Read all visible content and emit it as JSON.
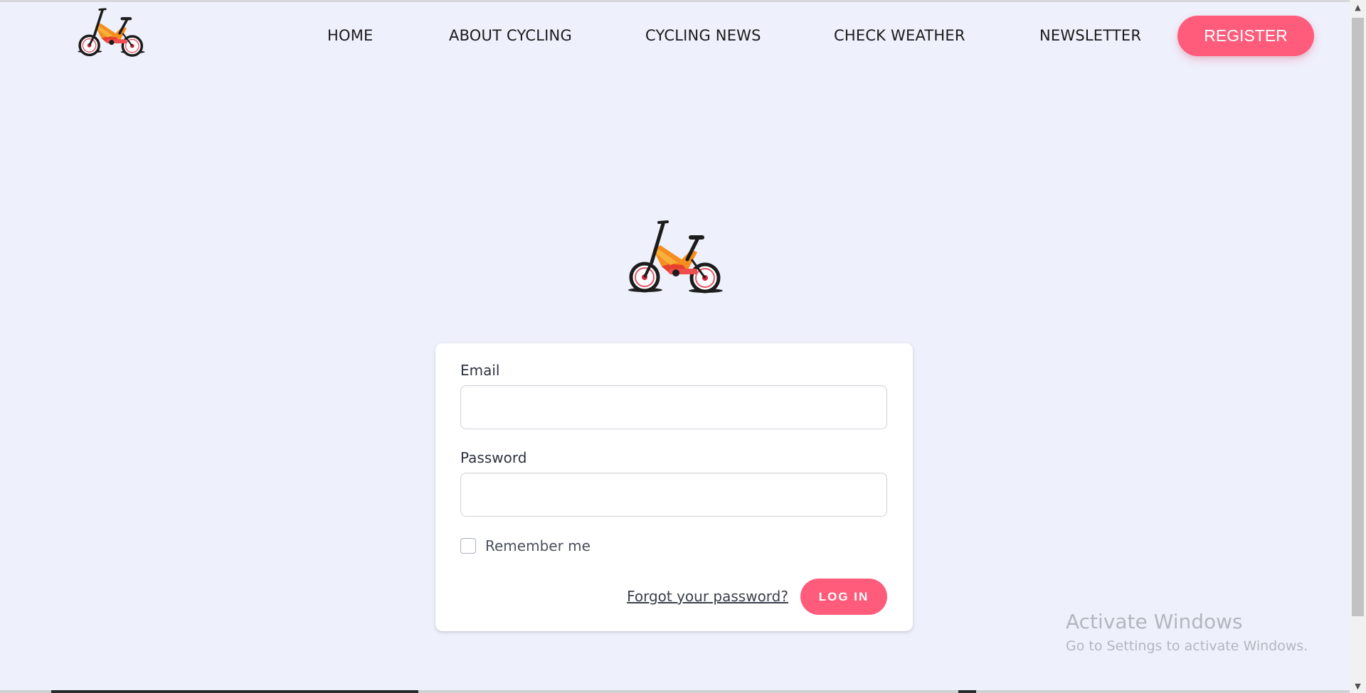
{
  "header": {
    "logo_icon": "bicycle-icon",
    "nav": [
      {
        "label": "HOME"
      },
      {
        "label": "ABOUT CYCLING"
      },
      {
        "label": "CYCLING NEWS"
      },
      {
        "label": "CHECK WEATHER"
      },
      {
        "label": "NEWSLETTER"
      }
    ],
    "register_label": "REGISTER"
  },
  "login": {
    "logo_icon": "bicycle-icon",
    "email_label": "Email",
    "email_value": "",
    "password_label": "Password",
    "password_value": "",
    "remember_label": "Remember me",
    "remember_checked": false,
    "forgot_label": "Forgot your password?",
    "submit_label": "LOG IN"
  },
  "watermark": {
    "title": "Activate Windows",
    "subtitle": "Go to Settings to activate Windows."
  },
  "colors": {
    "background": "#eef0fc",
    "accent": "#ff5c7c",
    "card": "#ffffff"
  }
}
